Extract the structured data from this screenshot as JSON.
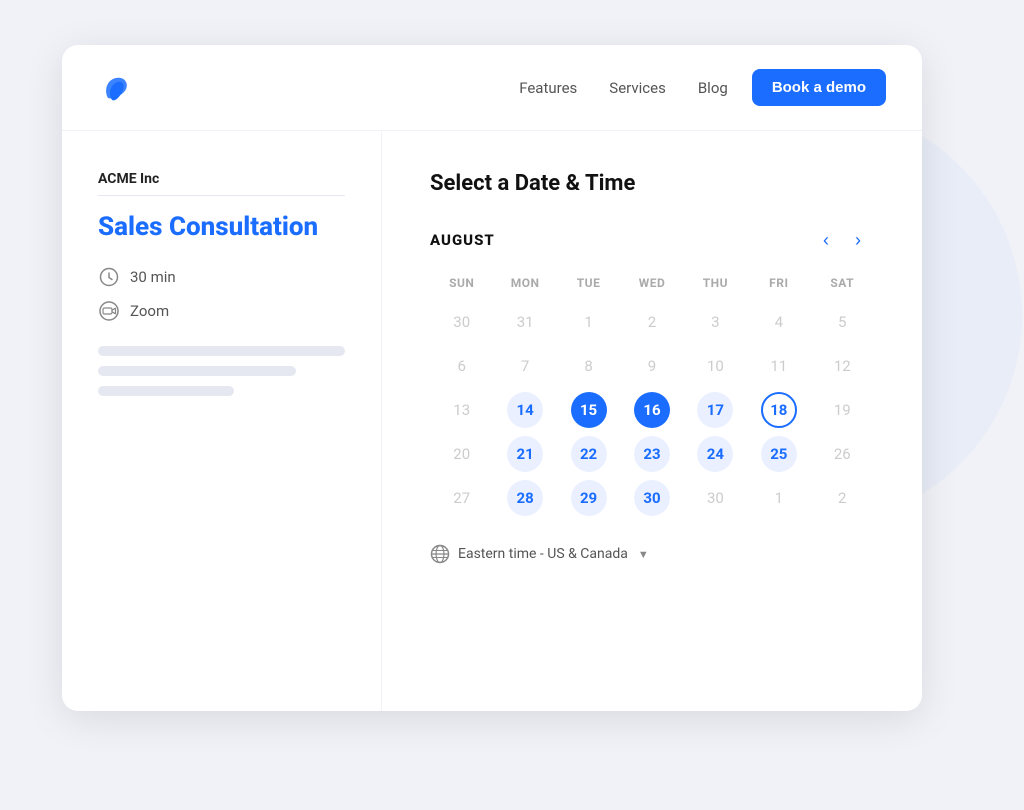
{
  "nav": {
    "links": [
      {
        "id": "features",
        "label": "Features"
      },
      {
        "id": "services",
        "label": "Services"
      },
      {
        "id": "blog",
        "label": "Blog"
      }
    ],
    "cta_label": "Book a demo"
  },
  "left": {
    "company": "ACME Inc",
    "event_title": "Sales Consultation",
    "duration": "30 min",
    "platform": "Zoom"
  },
  "right": {
    "title": "Select a Date & Time",
    "month": "AUGUST",
    "days_header": [
      "SUN",
      "MON",
      "TUE",
      "WED",
      "THU",
      "FRI",
      "SAT"
    ],
    "weeks": [
      [
        {
          "day": "30",
          "state": "other-month"
        },
        {
          "day": "31",
          "state": "other-month"
        },
        {
          "day": "1",
          "state": "inactive"
        },
        {
          "day": "2",
          "state": "inactive"
        },
        {
          "day": "3",
          "state": "inactive"
        },
        {
          "day": "4",
          "state": "inactive"
        },
        {
          "day": "5",
          "state": "inactive"
        }
      ],
      [
        {
          "day": "6",
          "state": "inactive"
        },
        {
          "day": "7",
          "state": "inactive"
        },
        {
          "day": "8",
          "state": "inactive"
        },
        {
          "day": "9",
          "state": "inactive"
        },
        {
          "day": "10",
          "state": "inactive"
        },
        {
          "day": "11",
          "state": "inactive"
        },
        {
          "day": "12",
          "state": "inactive"
        }
      ],
      [
        {
          "day": "13",
          "state": "inactive"
        },
        {
          "day": "14",
          "state": "available"
        },
        {
          "day": "15",
          "state": "selected-solid"
        },
        {
          "day": "16",
          "state": "selected-solid"
        },
        {
          "day": "17",
          "state": "available"
        },
        {
          "day": "18",
          "state": "selected-outline"
        },
        {
          "day": "19",
          "state": "inactive"
        }
      ],
      [
        {
          "day": "20",
          "state": "inactive"
        },
        {
          "day": "21",
          "state": "available"
        },
        {
          "day": "22",
          "state": "available"
        },
        {
          "day": "23",
          "state": "available"
        },
        {
          "day": "24",
          "state": "available"
        },
        {
          "day": "25",
          "state": "available"
        },
        {
          "day": "26",
          "state": "inactive"
        }
      ],
      [
        {
          "day": "27",
          "state": "inactive"
        },
        {
          "day": "28",
          "state": "available"
        },
        {
          "day": "29",
          "state": "available"
        },
        {
          "day": "30",
          "state": "available"
        },
        {
          "day": "30",
          "state": "inactive"
        },
        {
          "day": "1",
          "state": "other-month"
        },
        {
          "day": "2",
          "state": "other-month"
        }
      ]
    ],
    "timezone": "Eastern time - US & Canada"
  }
}
